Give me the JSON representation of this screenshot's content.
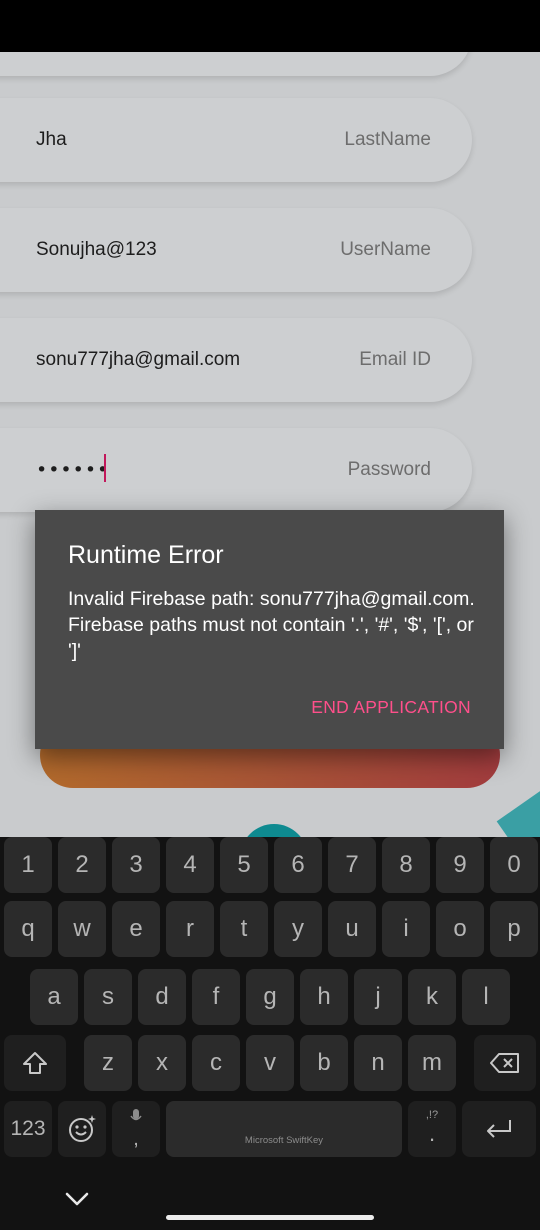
{
  "form": {
    "lastname": {
      "value": "Jha",
      "hint": "LastName"
    },
    "username": {
      "value": "Sonujha@123",
      "hint": "UserName"
    },
    "email": {
      "value": "sonu777jha@gmail.com",
      "hint": "Email ID"
    },
    "password": {
      "masked_value": "••••••",
      "hint": "Password"
    }
  },
  "dialog": {
    "title": "Runtime Error",
    "message": "Invalid Firebase path: sonu777jha@gmail.com. Firebase paths must not contain '.', '#', '$', '[', or ']'",
    "button_label": "END APPLICATION",
    "button_color": "#ff4f8b"
  },
  "keyboard": {
    "number_row": [
      "1",
      "2",
      "3",
      "4",
      "5",
      "6",
      "7",
      "8",
      "9",
      "0"
    ],
    "row1": [
      "q",
      "w",
      "e",
      "r",
      "t",
      "y",
      "u",
      "i",
      "o",
      "p"
    ],
    "row2": [
      "a",
      "s",
      "d",
      "f",
      "g",
      "h",
      "j",
      "k",
      "l"
    ],
    "row3": [
      "z",
      "x",
      "c",
      "v",
      "b",
      "n",
      "m"
    ],
    "symbols_label": "123",
    "comma_label": ",",
    "period_label": ".",
    "period_hint": ",!?",
    "space_label": "Microsoft SwiftKey",
    "icons": [
      "shift-icon",
      "backspace-icon",
      "emoji-icon",
      "microphone-icon",
      "enter-icon",
      "chevron-down-icon"
    ]
  },
  "colors": {
    "accent_caret": "#c2185b",
    "dialog_bg": "#4a4a4a"
  }
}
